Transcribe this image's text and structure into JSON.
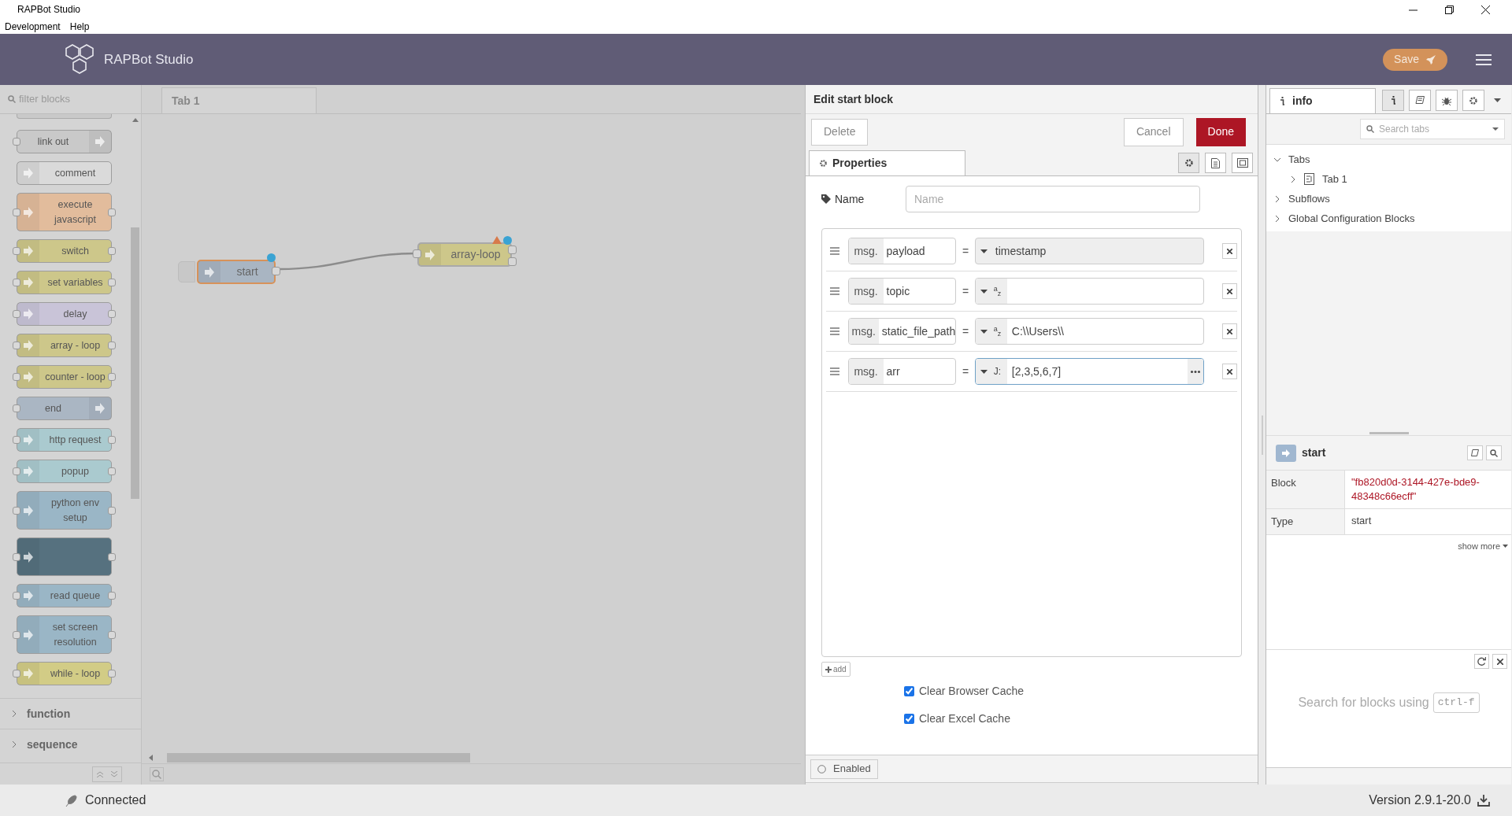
{
  "window": {
    "title": "RAPBot Studio"
  },
  "menu": [
    "Development",
    "Help"
  ],
  "header": {
    "brand": "RAPBot Studio",
    "save_label": "Save"
  },
  "palette": {
    "filter_placeholder": "filter blocks",
    "blocks": [
      {
        "label": "link out",
        "color": "#c9c9c9",
        "kind": "terminal"
      },
      {
        "label": "comment",
        "color": "#dadada",
        "kind": "comment"
      },
      {
        "label": "execute javascript",
        "color": "#e2bc9c",
        "kind": "node"
      },
      {
        "label": "switch",
        "color": "#cdc78a",
        "kind": "node"
      },
      {
        "label": "set variables",
        "color": "#cdc78a",
        "kind": "node"
      },
      {
        "label": "delay",
        "color": "#c9c4d8",
        "kind": "node"
      },
      {
        "label": "array - loop",
        "color": "#cdc78a",
        "kind": "node"
      },
      {
        "label": "counter - loop",
        "color": "#cdc78a",
        "kind": "node"
      },
      {
        "label": "end",
        "color": "#aab6c3",
        "kind": "terminal"
      },
      {
        "label": "http request",
        "color": "#aacacf",
        "kind": "node"
      },
      {
        "label": "popup",
        "color": "#aacacf",
        "kind": "node"
      },
      {
        "label": "python env setup",
        "color": "#9ab6c6",
        "kind": "node"
      },
      {
        "color": "#56717f",
        "kind": "node"
      },
      {
        "label": "read queue",
        "color": "#9ab6c6",
        "kind": "node"
      },
      {
        "label": "set screen resolution",
        "color": "#9ab6c6",
        "kind": "node"
      },
      {
        "label": "while - loop",
        "color": "#d2cc86",
        "kind": "node"
      }
    ],
    "categories": [
      {
        "label": "function",
        "expanded": false
      },
      {
        "label": "sequence",
        "expanded": false
      }
    ]
  },
  "canvas": {
    "tabs": [
      {
        "label": "Tab 1",
        "selected": true
      }
    ],
    "nodes": [
      {
        "label": "start",
        "color": "#a9b5c2",
        "selected": true,
        "warning": false
      },
      {
        "label": "array-loop",
        "color": "#cdc78a",
        "selected": false,
        "warning": true
      }
    ]
  },
  "editor": {
    "title": "Edit start block",
    "delete_label": "Delete",
    "cancel_label": "Cancel",
    "done_label": "Done",
    "tabs": [
      {
        "label": "Properties",
        "selected": true
      }
    ],
    "name_label": "Name",
    "name_placeholder": "Name",
    "rows": [
      {
        "prefix": "msg.",
        "property": "payload",
        "operator": "=",
        "kind": "timestamp",
        "value": "timestamp",
        "focused": false
      },
      {
        "prefix": "msg.",
        "property": "topic",
        "operator": "=",
        "kind": "str",
        "type_label": "$^{a}$$_{z}$",
        "focused": false
      },
      {
        "prefix": "msg.",
        "property": "static_file_path",
        "operator": "=",
        "kind": "str",
        "type_label": "$^{a}$$_{z}$",
        "value": "C:\\\\Users\\\\",
        "focused": false
      },
      {
        "prefix": "msg.",
        "property": "arr",
        "operator": "=",
        "kind": "json",
        "type_label": "J:",
        "value": "[2,3,5,6,7]",
        "focused": true
      }
    ],
    "add_label": "add",
    "options": [
      {
        "label": "Clear Browser Cache",
        "checked": true
      },
      {
        "label": "Clear Excel Cache",
        "checked": true
      }
    ],
    "enabled_label": "Enabled"
  },
  "sidebar": {
    "tab": {
      "label": "info",
      "selected": true
    },
    "search_placeholder": "Search tabs",
    "tree": [
      {
        "label": "Tabs",
        "expanded": true,
        "children": [
          {
            "label": "Tab 1",
            "expanded": false
          }
        ]
      },
      {
        "label": "Subflows",
        "expanded": false
      },
      {
        "label": "Global Configuration Blocks",
        "expanded": false
      }
    ],
    "selected_block": {
      "title": "start",
      "properties": [
        {
          "key": "Block",
          "value": "\"fb820d0d-3144-427e-bde9-48348c66ecff\"",
          "kind": "id"
        },
        {
          "key": "Type",
          "value": "start",
          "kind": "text"
        }
      ],
      "show_more": "show more"
    },
    "help_text": "Search for blocks using",
    "help_key": "ctrl-f"
  },
  "status_bar": {
    "connection": "Connected",
    "version": "Version 2.9.1-20.0"
  }
}
